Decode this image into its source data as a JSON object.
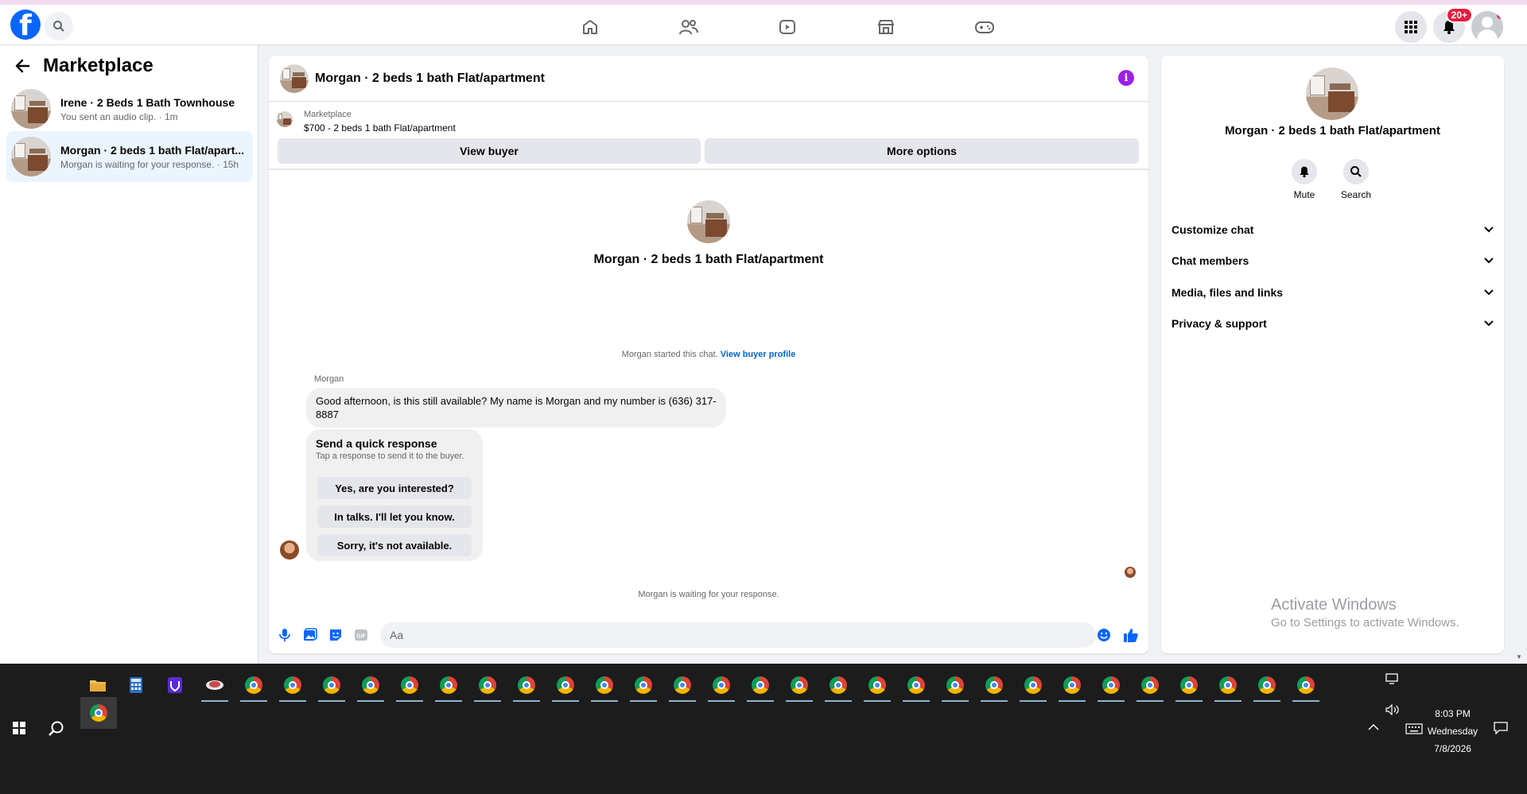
{
  "nav": {
    "icons": [
      "home-icon",
      "friends-icon",
      "watch-icon",
      "marketplace-icon",
      "gaming-icon"
    ],
    "notification_badge": "20+"
  },
  "sidebar": {
    "title": "Marketplace",
    "conversations": [
      {
        "title": "Irene · 2 Beds 1 Bath Townhouse",
        "subtitle": "You sent an audio clip. · 1m"
      },
      {
        "title": "Morgan · 2 beds 1 bath Flat/apart...",
        "subtitle": "Morgan is waiting for your response. · 15h"
      }
    ]
  },
  "chat": {
    "header_title": "Morgan · 2 beds 1 bath Flat/apartment",
    "listing_source": "Marketplace",
    "listing_price": "$700 - 2 beds 1 bath Flat/apartment",
    "view_buyer": "View buyer",
    "more_options": "More options",
    "thread_title": "Morgan · 2 beds 1 bath Flat/apartment",
    "started_text": "Morgan started this chat.",
    "view_profile": "View buyer profile",
    "sender": "Morgan",
    "message": "Good afternoon, is this still available? My name is Morgan and my number is (636) 317-8887",
    "quick_title": "Send a quick response",
    "quick_sub": "Tap a response to send it to the buyer.",
    "quick_replies": [
      "Yes, are you interested?",
      "In talks. I'll let you know.",
      "Sorry, it's not available."
    ],
    "waiting": "Morgan is waiting for your response.",
    "input_placeholder": "Aa"
  },
  "rpanel": {
    "title": "Morgan · 2 beds 1 bath Flat/apartment",
    "mute": "Mute",
    "search": "Search",
    "rows": [
      "Customize chat",
      "Chat members",
      "Media, files and links",
      "Privacy & support"
    ]
  },
  "watermark": {
    "line1": "Activate Windows",
    "line2": "Go to Settings to activate Windows."
  },
  "taskbar": {
    "time": "8:03 PM",
    "day": "Wednesday",
    "date": "7/8/2026"
  },
  "colors": {
    "accent": "#0866ff",
    "link": "#0064d1",
    "info": "#9b20e8",
    "badge": "#e41e3f"
  }
}
